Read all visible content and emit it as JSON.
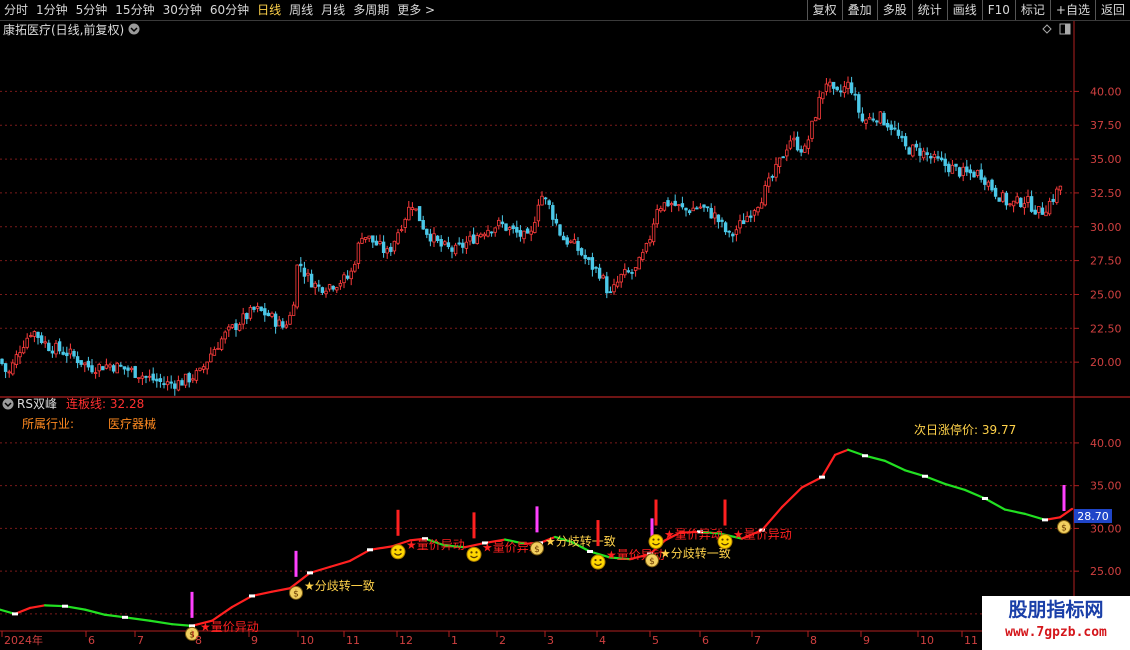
{
  "toolbar": {
    "periods": [
      "分时",
      "1分钟",
      "5分钟",
      "15分钟",
      "30分钟",
      "60分钟",
      "日线",
      "周线",
      "月线",
      "多周期",
      "更多 >"
    ],
    "active_period": "日线",
    "tools": [
      "复权",
      "叠加",
      "多股",
      "统计",
      "画线",
      "F10",
      "标记",
      "+自选",
      "返回"
    ]
  },
  "colors": {
    "up": "#ff3d3d",
    "down": "#4bc8e8",
    "rise_line": "#ff2020",
    "fall_line": "#22e022",
    "grid": "#7a1a1a",
    "axis_text": "#d04040",
    "yellow_text": "#ffd24a",
    "orange_text": "#ff8a20",
    "magenta": "#ff40ff"
  },
  "price_panel": {
    "title": "康拓医疗(日线,前复权)",
    "icons": [
      "chevron-down-icon",
      "diamond-icon",
      "panel-toggle-icon"
    ]
  },
  "indicator_panel": {
    "name": "RS双峰",
    "line_label": "连板线: 32.28",
    "industry_label": "所属行业:",
    "industry_value": "医疗器械",
    "limit_price": "次日涨停价: 39.77",
    "current_value": "28.70"
  },
  "watermark": {
    "title": "股朋指标网",
    "url": "www.7gpzb.com"
  },
  "chart_data": [
    {
      "type": "candlestick",
      "title": "康拓医疗(日线,前复权)",
      "ylim": [
        17.5,
        43.5
      ],
      "y_ticks": [
        "20.00",
        "22.50",
        "25.00",
        "27.50",
        "30.00",
        "32.50",
        "35.00",
        "37.50",
        "40.00"
      ],
      "x_ticks": [
        "2024年",
        "6",
        "7",
        "8",
        "9",
        "10",
        "11",
        "12",
        "1",
        "2",
        "3",
        "4",
        "5",
        "6",
        "7",
        "8",
        "9",
        "10",
        "11"
      ],
      "close_trend": [
        {
          "x": 0,
          "y": 20.2
        },
        {
          "x": 8,
          "y": 19.0
        },
        {
          "x": 20,
          "y": 21.0
        },
        {
          "x": 32,
          "y": 22.4
        },
        {
          "x": 48,
          "y": 21.2
        },
        {
          "x": 70,
          "y": 20.6
        },
        {
          "x": 90,
          "y": 19.6
        },
        {
          "x": 110,
          "y": 19.8
        },
        {
          "x": 130,
          "y": 19.4
        },
        {
          "x": 150,
          "y": 18.8
        },
        {
          "x": 165,
          "y": 18.4
        },
        {
          "x": 180,
          "y": 18.5
        },
        {
          "x": 200,
          "y": 19.2
        },
        {
          "x": 212,
          "y": 20.8
        },
        {
          "x": 225,
          "y": 22.0
        },
        {
          "x": 240,
          "y": 23.0
        },
        {
          "x": 255,
          "y": 23.9
        },
        {
          "x": 268,
          "y": 23.5
        },
        {
          "x": 283,
          "y": 22.6
        },
        {
          "x": 292,
          "y": 23.6
        },
        {
          "x": 298,
          "y": 27.6
        },
        {
          "x": 306,
          "y": 26.4
        },
        {
          "x": 318,
          "y": 25.5
        },
        {
          "x": 335,
          "y": 25.8
        },
        {
          "x": 350,
          "y": 26.3
        },
        {
          "x": 362,
          "y": 29.5
        },
        {
          "x": 375,
          "y": 28.8
        },
        {
          "x": 388,
          "y": 28.0
        },
        {
          "x": 400,
          "y": 30.0
        },
        {
          "x": 412,
          "y": 31.8
        },
        {
          "x": 425,
          "y": 29.8
        },
        {
          "x": 440,
          "y": 28.6
        },
        {
          "x": 455,
          "y": 28.2
        },
        {
          "x": 470,
          "y": 29.0
        },
        {
          "x": 485,
          "y": 29.8
        },
        {
          "x": 500,
          "y": 30.2
        },
        {
          "x": 515,
          "y": 29.6
        },
        {
          "x": 530,
          "y": 29.0
        },
        {
          "x": 540,
          "y": 32.5
        },
        {
          "x": 550,
          "y": 31.4
        },
        {
          "x": 562,
          "y": 29.2
        },
        {
          "x": 575,
          "y": 28.6
        },
        {
          "x": 590,
          "y": 27.2
        },
        {
          "x": 600,
          "y": 26.6
        },
        {
          "x": 610,
          "y": 24.9
        },
        {
          "x": 622,
          "y": 26.4
        },
        {
          "x": 635,
          "y": 26.7
        },
        {
          "x": 648,
          "y": 28.6
        },
        {
          "x": 657,
          "y": 31.5
        },
        {
          "x": 670,
          "y": 31.8
        },
        {
          "x": 685,
          "y": 31.2
        },
        {
          "x": 700,
          "y": 31.5
        },
        {
          "x": 715,
          "y": 30.8
        },
        {
          "x": 730,
          "y": 29.2
        },
        {
          "x": 745,
          "y": 30.6
        },
        {
          "x": 760,
          "y": 32.0
        },
        {
          "x": 775,
          "y": 34.0
        },
        {
          "x": 790,
          "y": 36.5
        },
        {
          "x": 805,
          "y": 35.6
        },
        {
          "x": 818,
          "y": 39.0
        },
        {
          "x": 826,
          "y": 40.8
        },
        {
          "x": 835,
          "y": 39.6
        },
        {
          "x": 850,
          "y": 40.6
        },
        {
          "x": 862,
          "y": 37.8
        },
        {
          "x": 878,
          "y": 38.2
        },
        {
          "x": 892,
          "y": 37.4
        },
        {
          "x": 905,
          "y": 35.8
        },
        {
          "x": 920,
          "y": 35.6
        },
        {
          "x": 935,
          "y": 34.9
        },
        {
          "x": 950,
          "y": 34.4
        },
        {
          "x": 965,
          "y": 33.9
        },
        {
          "x": 980,
          "y": 34.0
        },
        {
          "x": 995,
          "y": 32.6
        },
        {
          "x": 1010,
          "y": 31.6
        },
        {
          "x": 1025,
          "y": 32.0
        },
        {
          "x": 1040,
          "y": 31.0
        },
        {
          "x": 1052,
          "y": 32.0
        },
        {
          "x": 1062,
          "y": 33.2
        }
      ]
    },
    {
      "type": "line",
      "title": "RS双峰",
      "ylim": [
        18,
        43.5
      ],
      "y_ticks": [
        "20.00",
        "25.00",
        "30.00",
        "35.00",
        "40.00"
      ],
      "series": [
        {
          "name": "连板线",
          "points": [
            {
              "x": 0,
              "y": 20.5
            },
            {
              "x": 15,
              "y": 20.0
            },
            {
              "x": 30,
              "y": 20.7
            },
            {
              "x": 45,
              "y": 21.0
            },
            {
              "x": 65,
              "y": 20.9
            },
            {
              "x": 85,
              "y": 20.5
            },
            {
              "x": 105,
              "y": 19.9
            },
            {
              "x": 125,
              "y": 19.6
            },
            {
              "x": 150,
              "y": 19.2
            },
            {
              "x": 172,
              "y": 18.8
            },
            {
              "x": 192,
              "y": 18.6
            },
            {
              "x": 212,
              "y": 19.2
            },
            {
              "x": 232,
              "y": 20.8
            },
            {
              "x": 252,
              "y": 22.1
            },
            {
              "x": 272,
              "y": 22.6
            },
            {
              "x": 290,
              "y": 23.0
            },
            {
              "x": 310,
              "y": 24.8
            },
            {
              "x": 330,
              "y": 25.5
            },
            {
              "x": 350,
              "y": 26.2
            },
            {
              "x": 370,
              "y": 27.5
            },
            {
              "x": 392,
              "y": 27.9
            },
            {
              "x": 410,
              "y": 28.6
            },
            {
              "x": 425,
              "y": 28.8
            },
            {
              "x": 445,
              "y": 28.0
            },
            {
              "x": 465,
              "y": 27.8
            },
            {
              "x": 485,
              "y": 28.3
            },
            {
              "x": 505,
              "y": 28.7
            },
            {
              "x": 525,
              "y": 28.2
            },
            {
              "x": 540,
              "y": 28.3
            },
            {
              "x": 555,
              "y": 29.0
            },
            {
              "x": 572,
              "y": 28.4
            },
            {
              "x": 590,
              "y": 27.3
            },
            {
              "x": 610,
              "y": 26.6
            },
            {
              "x": 630,
              "y": 26.4
            },
            {
              "x": 650,
              "y": 27.0
            },
            {
              "x": 665,
              "y": 28.6
            },
            {
              "x": 680,
              "y": 29.5
            },
            {
              "x": 700,
              "y": 29.6
            },
            {
              "x": 720,
              "y": 29.4
            },
            {
              "x": 742,
              "y": 28.8
            },
            {
              "x": 762,
              "y": 29.8
            },
            {
              "x": 782,
              "y": 32.5
            },
            {
              "x": 802,
              "y": 34.8
            },
            {
              "x": 822,
              "y": 36.0
            },
            {
              "x": 835,
              "y": 38.6
            },
            {
              "x": 848,
              "y": 39.2
            },
            {
              "x": 865,
              "y": 38.5
            },
            {
              "x": 885,
              "y": 37.9
            },
            {
              "x": 905,
              "y": 36.8
            },
            {
              "x": 925,
              "y": 36.1
            },
            {
              "x": 945,
              "y": 35.2
            },
            {
              "x": 965,
              "y": 34.5
            },
            {
              "x": 985,
              "y": 33.5
            },
            {
              "x": 1005,
              "y": 32.2
            },
            {
              "x": 1025,
              "y": 31.7
            },
            {
              "x": 1045,
              "y": 31.0
            },
            {
              "x": 1060,
              "y": 31.3
            },
            {
              "x": 1072,
              "y": 32.28
            }
          ]
        }
      ],
      "signals": [
        {
          "x": 192,
          "y": 18.6,
          "label": "量价异动",
          "color": "#ff2020",
          "icon": "moneybag-icon"
        },
        {
          "x": 296,
          "y": 23.4,
          "label": "分歧转一致",
          "color": "#ffd24a",
          "icon": "moneybag-icon"
        },
        {
          "x": 398,
          "y": 28.2,
          "label": "量价异动",
          "color": "#ff2020",
          "icon": "smiley-icon"
        },
        {
          "x": 474,
          "y": 27.9,
          "label": "量价异动",
          "color": "#ff2020",
          "icon": "smiley-icon"
        },
        {
          "x": 537,
          "y": 28.6,
          "label": "分歧转一致",
          "color": "#ffd24a",
          "icon": "moneybag-icon"
        },
        {
          "x": 598,
          "y": 27.0,
          "label": "量价异动",
          "color": "#ff2020",
          "icon": "smiley-icon"
        },
        {
          "x": 652,
          "y": 27.2,
          "label": "分歧转一致",
          "color": "#ffd24a",
          "icon": "moneybag-icon"
        },
        {
          "x": 656,
          "y": 29.4,
          "label": "量价异动",
          "color": "#ff2020",
          "icon": "smiley-icon"
        },
        {
          "x": 725,
          "y": 29.4,
          "label": "量价异动",
          "color": "#ff2020",
          "icon": "smiley-icon"
        },
        {
          "x": 1064,
          "y": 31.1,
          "label": "",
          "color": "#ffd24a",
          "icon": "moneybag-icon"
        }
      ]
    }
  ]
}
